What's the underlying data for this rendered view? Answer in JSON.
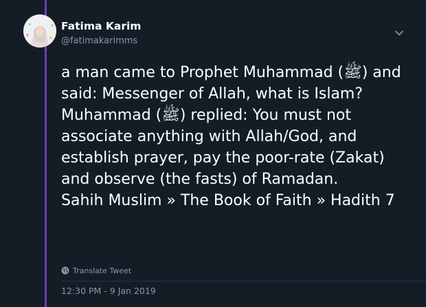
{
  "tweet": {
    "author_name": "Fatima Karim",
    "author_handle": "@fatimakarimms",
    "text": "a man came to Prophet Muhammad (ﷺ) and said: Messenger of Allah, what is Islam? Muhammad (ﷺ) replied: You must not associate anything with Allah/God, and establish prayer, pay the poor-rate (Zakat) and observe (the fasts) of Ramadan.\nSahih Muslim » The Book of Faith » Hadith 7",
    "translate_label": "Translate Tweet",
    "timestamp": "12:30 PM - 9 Jan 2019"
  },
  "icons": {
    "more": "chevron-down-icon",
    "translate": "globe-icon"
  },
  "colors": {
    "background": "#141d26",
    "thread_line": "#6b3fb8",
    "primary_text": "#ffffff",
    "secondary_text": "#8899a6"
  }
}
